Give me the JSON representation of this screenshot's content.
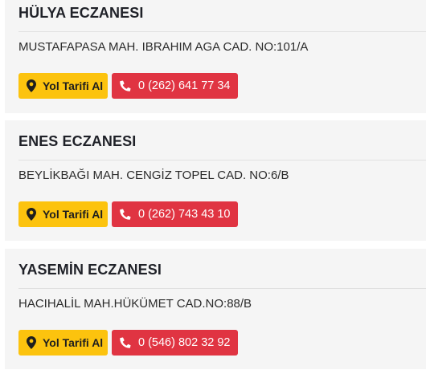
{
  "pharmacies": [
    {
      "name": "HÜLYA ECZANESI",
      "address": "MUSTAFAPASA MAH. IBRAHIM AGA CAD. NO:101/A",
      "directions_label": "Yol Tarifi Al",
      "phone": "0 (262) 641 77 34"
    },
    {
      "name": "ENES ECZANESI",
      "address": "BEYLİKBAĞI MAH. CENGİZ TOPEL CAD. NO:6/B",
      "directions_label": "Yol Tarifi Al",
      "phone": "0 (262) 743 43 10"
    },
    {
      "name": "YASEMİN ECZANESI",
      "address": "HACIHALİL MAH.HÜKÜMET CAD.NO:88/B",
      "directions_label": "Yol Tarifi Al",
      "phone": "0 (546) 802 32 92"
    }
  ],
  "icons": {
    "directions": "map-pin-icon",
    "call": "phone-icon"
  },
  "colors": {
    "directions_button": "#fcc30e",
    "call_button": "#e03442",
    "card_background": "#f5f5f5"
  }
}
